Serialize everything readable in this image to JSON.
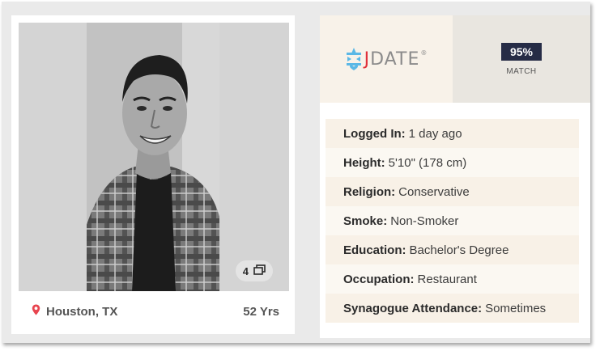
{
  "profile": {
    "photo_count": "4",
    "location": "Houston, TX",
    "age": "52 Yrs"
  },
  "brand": {
    "name_j": "J",
    "name_rest": "DATE",
    "registered": "®"
  },
  "match": {
    "percent": "95%",
    "label": "MATCH"
  },
  "details": [
    {
      "label": "Logged In:",
      "value": "1 day ago"
    },
    {
      "label": "Height:",
      "value": "5'10\" (178 cm)"
    },
    {
      "label": "Religion:",
      "value": "Conservative"
    },
    {
      "label": "Smoke:",
      "value": "Non-Smoker"
    },
    {
      "label": "Education:",
      "value": "Bachelor's Degree"
    },
    {
      "label": "Occupation:",
      "value": "Restaurant"
    },
    {
      "label": "Synagogue Attendance:",
      "value": "Sometimes"
    }
  ],
  "colors": {
    "brand_red": "#e0303a",
    "brand_blue": "#5bb8e6",
    "match_badge": "#262c46",
    "location_pin": "#e8454f"
  },
  "icons": {
    "location": "map-pin-icon",
    "photos": "photo-stack-icon",
    "logo": "star-of-david-icon"
  }
}
